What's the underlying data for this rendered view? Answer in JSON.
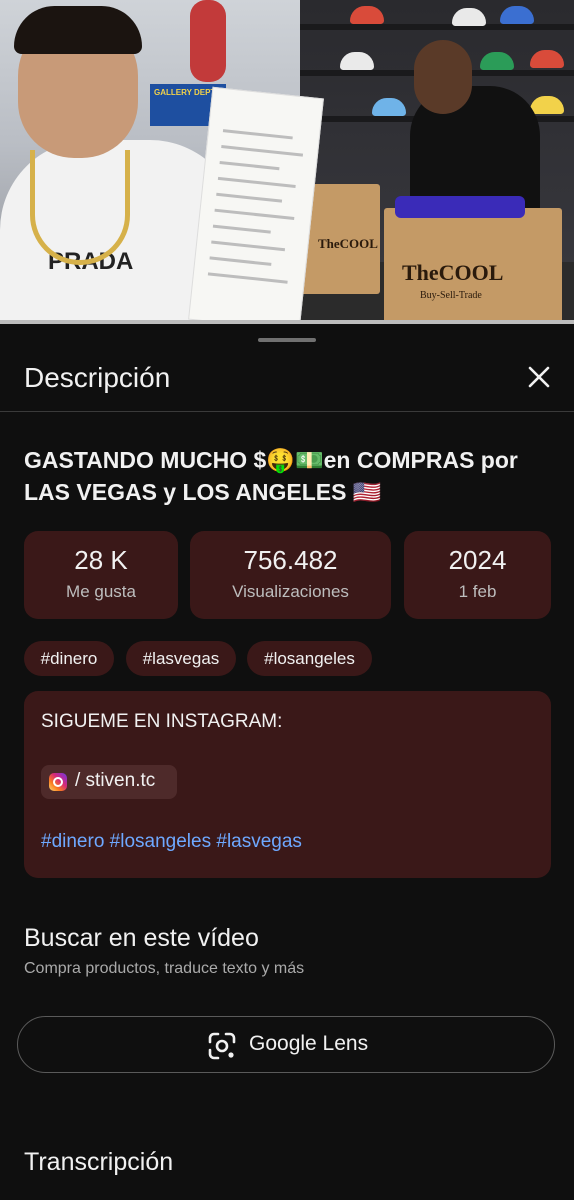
{
  "sheet": {
    "title": "Descripción"
  },
  "video": {
    "title": "GASTANDO MUCHO $🤑💵en COMPRAS por LAS VEGAS y LOS ANGELES 🇺🇸"
  },
  "stats": [
    {
      "value": "28 K",
      "label": "Me gusta"
    },
    {
      "value": "756.482",
      "label": "Visualizaciones"
    },
    {
      "value": "2024",
      "label": "1 feb"
    }
  ],
  "hashtags": [
    "#dinero",
    "#lasvegas",
    "#losangeles"
  ],
  "description": {
    "line1": "SIGUEME EN INSTAGRAM:",
    "instagram_handle": "/ stiven.tc",
    "tags": [
      "#dinero",
      "#losangeles",
      "#lasvegas"
    ]
  },
  "search_video": {
    "title": "Buscar en este vídeo",
    "subtitle": "Compra productos, traduce texto y más",
    "lens_button": "Google Lens"
  },
  "transcript": {
    "title": "Transcripción"
  },
  "thumbnail_text": {
    "bag_brand": "TheCOOL",
    "bag_tagline": "Buy-Sell-Trade",
    "shirt_brand": "PRADA",
    "store_sign": "GALLERY DEPT."
  },
  "colors": {
    "background": "#0f0f0f",
    "card": "#3a1818",
    "link": "#6ea8ff",
    "text": "#f1f1f1",
    "muted": "#aaaaaa"
  }
}
